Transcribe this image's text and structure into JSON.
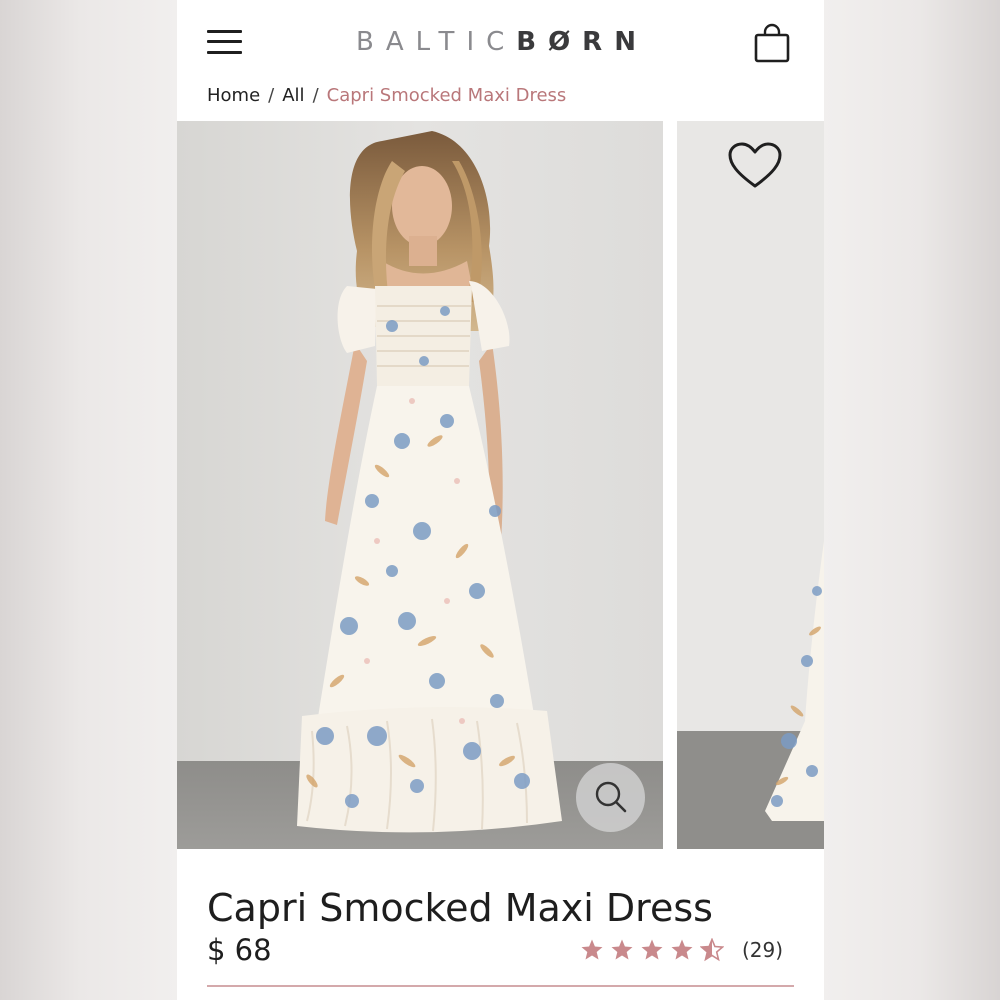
{
  "header": {
    "brand_light": "BALTIC",
    "brand_dark": "BØRN",
    "menu_icon": "hamburger-icon",
    "bag_icon": "shopping-bag-icon"
  },
  "breadcrumb": {
    "items": [
      "Home",
      "All"
    ],
    "separator": "/",
    "current": "Capri Smocked Maxi Dress"
  },
  "gallery": {
    "heart_icon": "heart-icon",
    "zoom_icon": "search-icon"
  },
  "product": {
    "title": "Capri Smocked Maxi Dress",
    "price": "$ 68",
    "rating": 4.5,
    "review_count": "(29)"
  },
  "colors": {
    "accent": "#b9777a",
    "star": "#c9898c",
    "text": "#1e1e1e"
  }
}
